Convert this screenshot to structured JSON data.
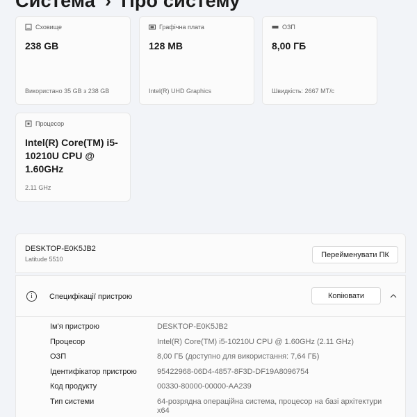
{
  "header": {
    "breadcrumb_parent": "Система",
    "separator": "›",
    "title": "Про систему"
  },
  "cards": {
    "storage": {
      "label": "Сховище",
      "value": "238 GB",
      "sub": "Використано 35 GB з 238 GB",
      "icon": "storage-icon"
    },
    "graphics": {
      "label": "Графічна плата",
      "value": "128 MB",
      "sub": "Intel(R) UHD Graphics",
      "icon": "graphics-card-icon"
    },
    "ram": {
      "label": "ОЗП",
      "value": "8,00 ГБ",
      "sub": "Швидкість: 2667 MT/с",
      "icon": "memory-icon"
    },
    "cpu": {
      "label": "Процесор",
      "value": "Intel(R) Core(TM) i5-10210U CPU @ 1.60GHz",
      "sub": "2.11 GHz",
      "icon": "processor-icon"
    }
  },
  "device": {
    "name": "DESKTOP-E0K5JB2",
    "model": "Latitude 5510",
    "rename_button": "Перейменувати ПК"
  },
  "specs": {
    "title": "Специфікації пристрою",
    "copy_button": "Копіювати",
    "rows": [
      {
        "label": "Ім'я пристрою",
        "value": "DESKTOP-E0K5JB2"
      },
      {
        "label": "Процесор",
        "value": "Intel(R) Core(TM) i5-10210U CPU @ 1.60GHz (2.11 GHz)"
      },
      {
        "label": "ОЗП",
        "value": "8,00 ГБ (доступно для використання: 7,64 ГБ)"
      },
      {
        "label": "Ідентифікатор пристрою",
        "value": "95422968-06D4-4857-8F3D-DF19A8096754"
      },
      {
        "label": "Код продукту",
        "value": "00330-80000-00000-AA239"
      },
      {
        "label": "Тип системи",
        "value": "64-розрядна операційна система, процесор на базі архітектури x64"
      }
    ]
  },
  "colors": {
    "background": "#f2f4f8",
    "card": "#fbfbfb",
    "text": "#1b1b1b",
    "muted": "#6b6b6b"
  }
}
